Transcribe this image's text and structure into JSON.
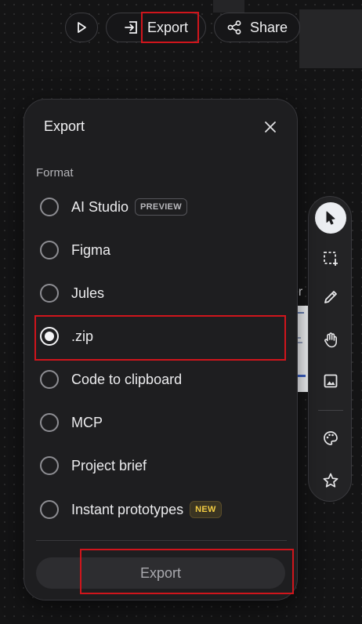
{
  "header": {
    "play_icon": "play-icon",
    "export_label": "Export",
    "export_icon": "export-arrow-icon",
    "share_label": "Share",
    "share_icon": "share-icon"
  },
  "canvas": {
    "partial_text": "er"
  },
  "dialog": {
    "title": "Export",
    "close_icon": "close-icon",
    "format_label": "Format",
    "options": [
      {
        "label": "AI Studio",
        "badge": "PREVIEW",
        "selected": false
      },
      {
        "label": "Figma",
        "badge": "",
        "selected": false
      },
      {
        "label": "Jules",
        "badge": "",
        "selected": false
      },
      {
        "label": ".zip",
        "badge": "",
        "selected": true
      },
      {
        "label": "Code to clipboard",
        "badge": "",
        "selected": false
      },
      {
        "label": "MCP",
        "badge": "",
        "selected": false
      },
      {
        "label": "Project brief",
        "badge": "",
        "selected": false
      },
      {
        "label": "Instant prototypes",
        "badge": "NEW",
        "selected": false
      }
    ],
    "export_button_label": "Export"
  },
  "toolbar": {
    "tools": [
      "pointer-icon",
      "marquee-select-icon",
      "pencil-icon",
      "hand-icon",
      "image-icon",
      "palette-icon",
      "star-icon"
    ],
    "active_tool": "pointer-icon"
  },
  "colors": {
    "background": "#141415",
    "panel": "#1e1e20",
    "highlight_box": "#d0151c",
    "new_badge": "#f2cc43"
  }
}
